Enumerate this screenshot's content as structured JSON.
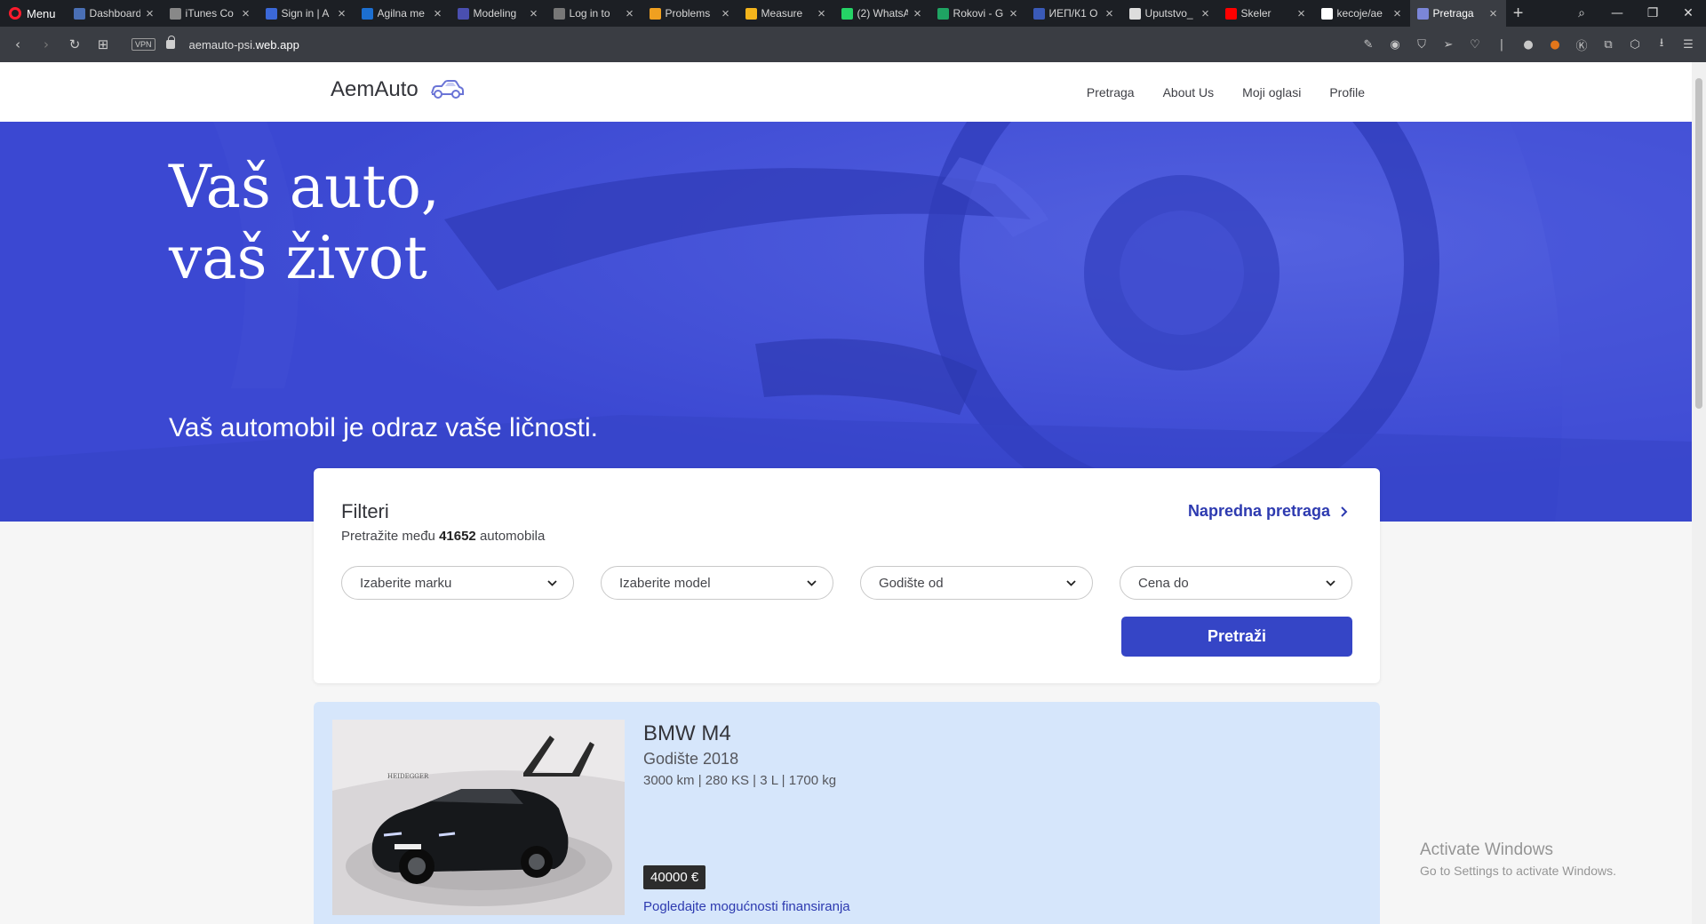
{
  "browser": {
    "menu_label": "Menu",
    "tabs": [
      {
        "label": "Dashboard",
        "favicon_color": "#4a6fb5"
      },
      {
        "label": "iTunes Co",
        "favicon_color": "#888888"
      },
      {
        "label": "Sign in | A",
        "favicon_color": "#3b68d8"
      },
      {
        "label": "Agilna me",
        "favicon_color": "#1c6fd1"
      },
      {
        "label": "Modeling",
        "favicon_color": "#4a4fb0"
      },
      {
        "label": "Log in to",
        "favicon_color": "#777777"
      },
      {
        "label": "Problems",
        "favicon_color": "#f0a020"
      },
      {
        "label": "Measure",
        "favicon_color": "#f3b41c"
      },
      {
        "label": "(2) WhatsA",
        "favicon_color": "#25d366"
      },
      {
        "label": "Rokovi - G",
        "favicon_color": "#1fa463"
      },
      {
        "label": "ИЕП/К1 О",
        "favicon_color": "#3a5ab8"
      },
      {
        "label": "Uputstvo_",
        "favicon_color": "#dddddd"
      },
      {
        "label": "Skeler",
        "favicon_color": "#ff0000"
      },
      {
        "label": "kecoje/ae",
        "favicon_color": "#ffffff"
      },
      {
        "label": "Pretraga",
        "favicon_color": "#7b86d8",
        "active": true
      }
    ],
    "address": {
      "vpn_label": "VPN",
      "url_prefix": "aemauto-psi.",
      "url_domain": "web.app"
    }
  },
  "site": {
    "brand": "AemAuto",
    "brand_color": "#3545c6",
    "nav": [
      "Pretraga",
      "About Us",
      "Moji oglasi",
      "Profile"
    ],
    "hero": {
      "title_line1": "Vaš auto,",
      "title_line2": "vaš život",
      "subtitle": "Vaš automobil je odraz vaše ličnosti."
    },
    "filters": {
      "title": "Filteri",
      "count_prefix": "Pretražite među",
      "count": "41652",
      "count_suffix": "automobila",
      "advanced_link": "Napredna pretraga",
      "selects": [
        "Izaberite marku",
        "Izaberite model",
        "Godište od",
        "Cena do"
      ],
      "search_button": "Pretraži"
    },
    "listing": {
      "title": "BMW M4",
      "year": "Godište 2018",
      "specs": "3000 km | 280 KS | 3 L | 1700 kg",
      "price": "40000 €",
      "financing_link": "Pogledajte mogućnosti finansiranja",
      "image_lettering": "HEIDEGGER"
    }
  },
  "os_overlay": {
    "line1": "Activate Windows",
    "line2": "Go to Settings to activate Windows."
  }
}
